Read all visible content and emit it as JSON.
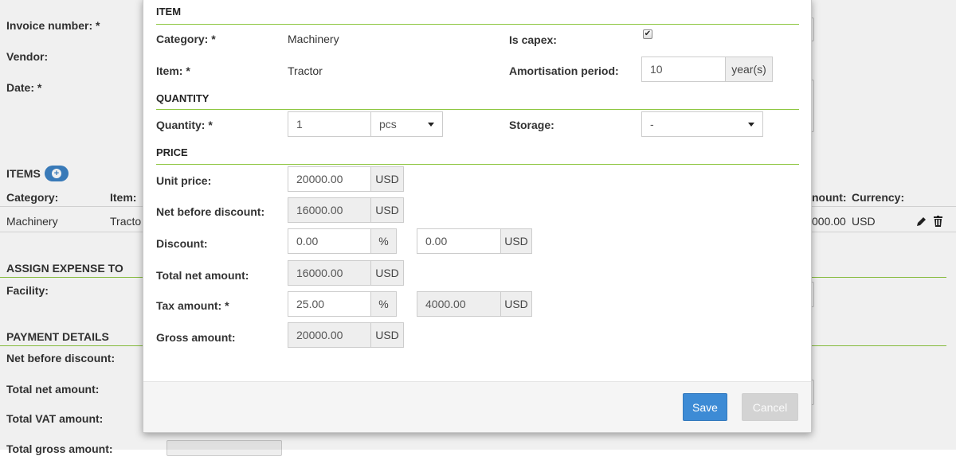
{
  "background": {
    "invoice_number_label": "Invoice number: *",
    "vendor_label": "Vendor:",
    "date_label": "Date: *",
    "items_title": "ITEMS",
    "items_add_icon": "plus-circle-icon",
    "items_columns": {
      "category": "Category:",
      "item": "Item:",
      "amount": "nount:",
      "currency": "Currency:"
    },
    "items_row": {
      "category": "Machinery",
      "item": "Tracto",
      "amount": "000.00",
      "currency": "USD"
    },
    "row_edit_icon": "pencil-icon",
    "row_delete_icon": "trash-icon",
    "assign_title": "ASSIGN EXPENSE TO",
    "facility_label": "Facility:",
    "payment_title": "PAYMENT DETAILS",
    "net_before_discount_label": "Net before discount:",
    "total_net_label": "Total net amount:",
    "total_vat_label": "Total VAT amount:",
    "total_gross_label": "Total gross amount:"
  },
  "modal": {
    "item_section": "ITEM",
    "category_label": "Category: *",
    "category_value": "Machinery",
    "is_capex_label": "Is capex:",
    "is_capex_checked": "✔",
    "item_label": "Item: *",
    "item_value": "Tractor",
    "amortisation_label": "Amortisation period:",
    "amortisation_value": "10",
    "amortisation_unit": "year(s)",
    "quantity_section": "QUANTITY",
    "quantity_label": "Quantity: *",
    "quantity_value": "1",
    "quantity_unit": "pcs",
    "storage_label": "Storage:",
    "storage_value": "-",
    "price_section": "PRICE",
    "unit_price_label": "Unit price:",
    "unit_price_value": "20000.00",
    "unit_price_currency": "USD",
    "net_before_discount_label": "Net before discount:",
    "net_before_discount_value": "16000.00",
    "net_before_discount_currency": "USD",
    "discount_label": "Discount:",
    "discount_percent": "0.00",
    "discount_percent_unit": "%",
    "discount_amount": "0.00",
    "discount_currency": "USD",
    "total_net_label": "Total net amount:",
    "total_net_value": "16000.00",
    "total_net_currency": "USD",
    "tax_label": "Tax amount: *",
    "tax_percent": "25.00",
    "tax_percent_unit": "%",
    "tax_amount": "4000.00",
    "tax_currency": "USD",
    "gross_label": "Gross amount:",
    "gross_value": "20000.00",
    "gross_currency": "USD",
    "save_label": "Save",
    "cancel_label": "Cancel"
  }
}
